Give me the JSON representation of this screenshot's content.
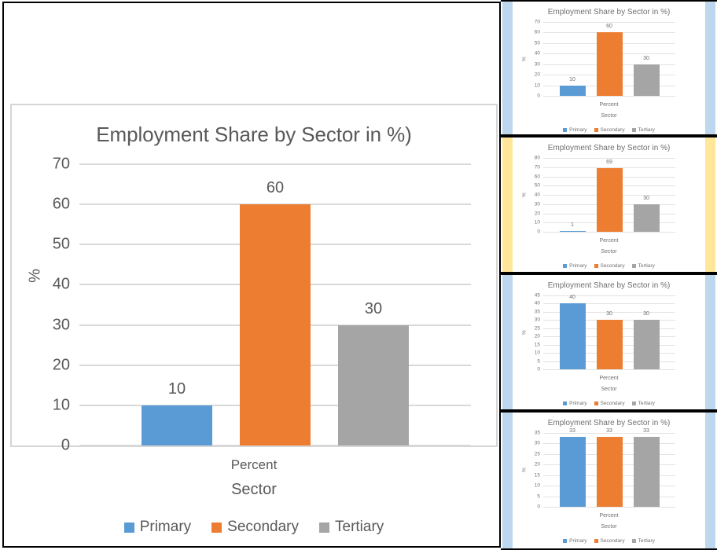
{
  "colors": {
    "primary": "#5B9BD5",
    "secondary": "#ED7D31",
    "tertiary": "#A5A5A5",
    "text": "#595959",
    "gridline": "#D9D9D9",
    "accent_blue": "#BDD7EE",
    "accent_yellow": "#FFE699",
    "slide_border": "#000000",
    "chart_frame": "#D5D5D5"
  },
  "legend": {
    "items": [
      {
        "label": "Primary",
        "color": "#5B9BD5"
      },
      {
        "label": "Secondary",
        "color": "#ED7D31"
      },
      {
        "label": "Tertiary",
        "color": "#A5A5A5"
      }
    ]
  },
  "main_chart": {
    "title": "Employment Share by Sector in %)",
    "ylabel": "%",
    "xlabel": "Sector",
    "category_label": "Percent"
  },
  "chart_data": [
    {
      "id": "main",
      "type": "bar",
      "title": "Employment Share by Sector in %)",
      "xlabel": "Sector",
      "ylabel": "%",
      "categories": [
        "Percent"
      ],
      "series": [
        {
          "name": "Primary",
          "values": [
            10
          ],
          "color": "#5B9BD5"
        },
        {
          "name": "Secondary",
          "values": [
            60
          ],
          "color": "#ED7D31"
        },
        {
          "name": "Tertiary",
          "values": [
            30
          ],
          "color": "#A5A5A5"
        }
      ],
      "bar_labels": [
        "10",
        "60",
        "30"
      ],
      "yticks": [
        0,
        10,
        20,
        30,
        40,
        50,
        60,
        70
      ],
      "ylim": [
        0,
        70
      ],
      "grid": true,
      "legend_position": "bottom"
    },
    {
      "id": "thumb-1",
      "type": "bar",
      "title": "Employment Share by Sector in %)",
      "xlabel": "Sector",
      "ylabel": "%",
      "categories": [
        "Percent"
      ],
      "series": [
        {
          "name": "Primary",
          "values": [
            10
          ],
          "color": "#5B9BD5"
        },
        {
          "name": "Secondary",
          "values": [
            60
          ],
          "color": "#ED7D31"
        },
        {
          "name": "Tertiary",
          "values": [
            30
          ],
          "color": "#A5A5A5"
        }
      ],
      "bar_labels": [
        "10",
        "60",
        "30"
      ],
      "yticks": [
        0,
        10,
        20,
        30,
        40,
        50,
        60,
        70
      ],
      "ylim": [
        0,
        70
      ],
      "grid": true,
      "legend_position": "bottom",
      "accent_color": "#BDD7EE"
    },
    {
      "id": "thumb-2",
      "type": "bar",
      "title": "Employment Share by Sector in %)",
      "xlabel": "Sector",
      "ylabel": "%",
      "categories": [
        "Percent"
      ],
      "series": [
        {
          "name": "Primary",
          "values": [
            1
          ],
          "color": "#5B9BD5"
        },
        {
          "name": "Secondary",
          "values": [
            69
          ],
          "color": "#ED7D31"
        },
        {
          "name": "Tertiary",
          "values": [
            30
          ],
          "color": "#A5A5A5"
        }
      ],
      "bar_labels": [
        "1",
        "69",
        "30"
      ],
      "yticks": [
        0,
        10,
        20,
        30,
        40,
        50,
        60,
        70,
        80
      ],
      "ylim": [
        0,
        80
      ],
      "grid": true,
      "legend_position": "bottom",
      "accent_color": "#FFE699"
    },
    {
      "id": "thumb-3",
      "type": "bar",
      "title": "Employment Share by Sector in %)",
      "xlabel": "Sector",
      "ylabel": "%",
      "categories": [
        "Percent"
      ],
      "series": [
        {
          "name": "Primary",
          "values": [
            40
          ],
          "color": "#5B9BD5"
        },
        {
          "name": "Secondary",
          "values": [
            30
          ],
          "color": "#ED7D31"
        },
        {
          "name": "Tertiary",
          "values": [
            30
          ],
          "color": "#A5A5A5"
        }
      ],
      "bar_labels": [
        "40",
        "30",
        "30"
      ],
      "yticks": [
        0,
        5,
        10,
        15,
        20,
        25,
        30,
        35,
        40,
        45
      ],
      "ylim": [
        0,
        45
      ],
      "grid": true,
      "legend_position": "bottom",
      "accent_color": "#BDD7EE"
    },
    {
      "id": "thumb-4",
      "type": "bar",
      "title": "Employment Share by Sector in %)",
      "xlabel": "Sector",
      "ylabel": "%",
      "categories": [
        "Percent"
      ],
      "series": [
        {
          "name": "Primary",
          "values": [
            33
          ],
          "color": "#5B9BD5"
        },
        {
          "name": "Secondary",
          "values": [
            33
          ],
          "color": "#ED7D31"
        },
        {
          "name": "Tertiary",
          "values": [
            33
          ],
          "color": "#A5A5A5"
        }
      ],
      "bar_labels": [
        "33",
        "33",
        "33"
      ],
      "yticks": [
        0,
        5,
        10,
        15,
        20,
        25,
        30,
        35
      ],
      "ylim": [
        0,
        35
      ],
      "grid": true,
      "legend_position": "bottom",
      "accent_color": "#BDD7EE"
    }
  ]
}
